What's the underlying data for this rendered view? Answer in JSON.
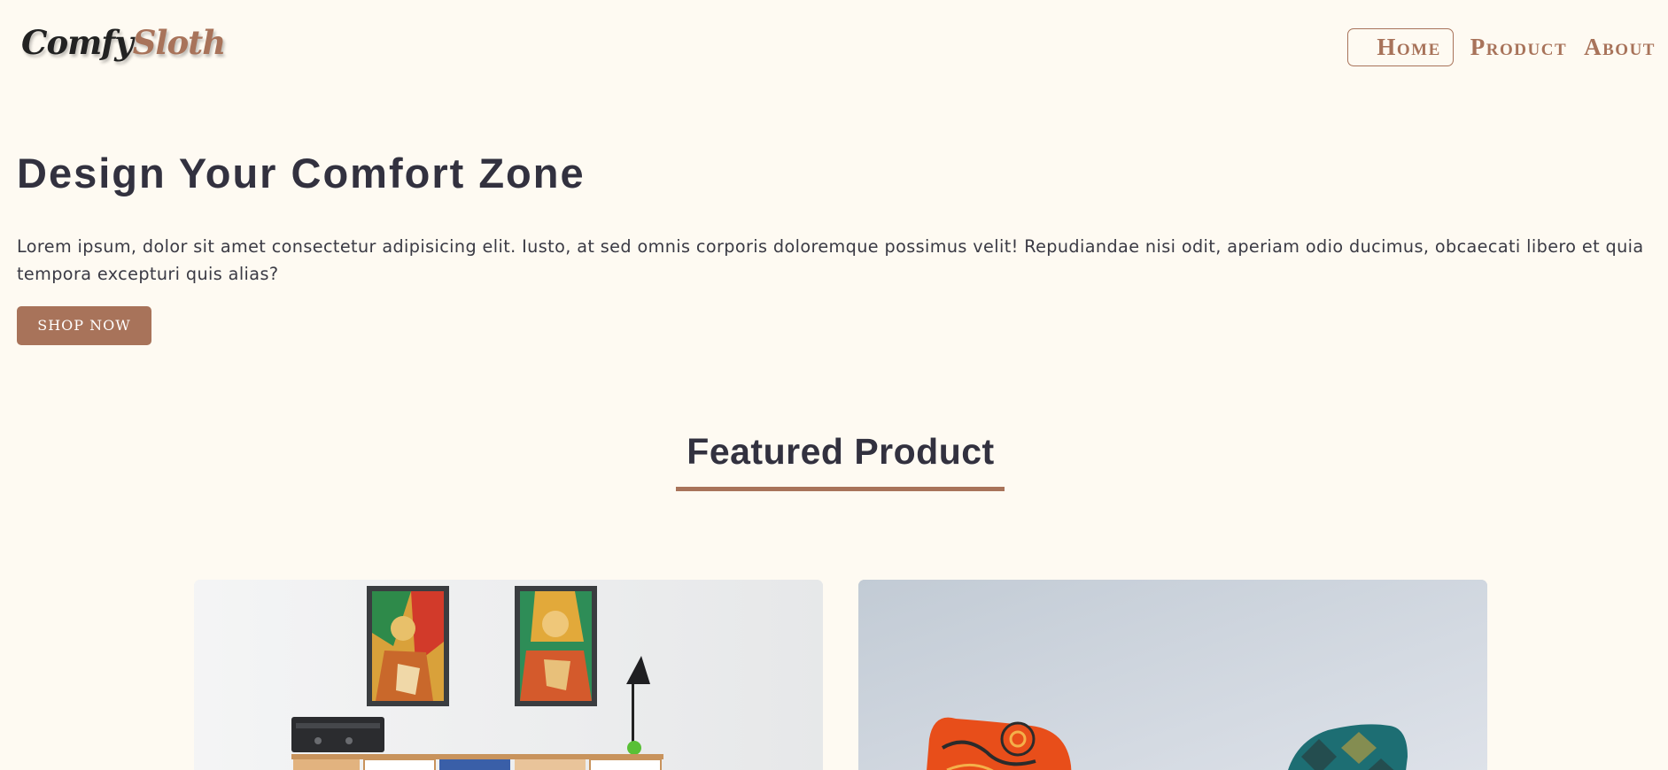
{
  "logo": {
    "part1": "Comfy",
    "part2": "Sloth"
  },
  "nav": {
    "items": [
      {
        "label": "Home",
        "active": true
      },
      {
        "label": "Product",
        "active": false
      },
      {
        "label": "About",
        "active": false
      }
    ]
  },
  "hero": {
    "title": "Design Your Comfort Zone",
    "text": "Lorem ipsum, dolor sit amet consectetur adipisicing elit. Iusto, at sed omnis corporis doloremque possimus velit! Repudiandae nisi odit, aperiam odio ducimus, obcaecati libero et quia tempora excepturi quis alias?",
    "button": "SHOP NOW"
  },
  "featured": {
    "title": "Featured Product",
    "products": [
      {
        "image": "shelf-with-paintings"
      },
      {
        "image": "colorful-armchairs"
      }
    ]
  },
  "colors": {
    "background": "#fefaf2",
    "accent": "#a8735a",
    "text": "#32313f"
  }
}
